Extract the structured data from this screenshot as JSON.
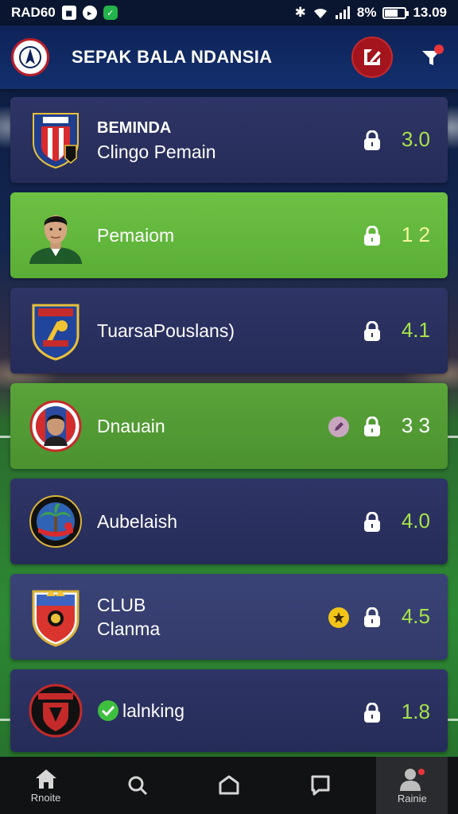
{
  "status_bar": {
    "left_text": "RAD60",
    "battery_text": "8%",
    "time": "13.09"
  },
  "header": {
    "title": "SEPAK BALA NDANSIA"
  },
  "list": [
    {
      "line1": "BEMINDA",
      "line2": "Clingo Pemain",
      "score": "3.0",
      "style": "dark",
      "icon": "club-crest-icon"
    },
    {
      "line1": "Pemaiom",
      "line2": "",
      "score": "1 2",
      "style": "green",
      "icon": "player-portrait-icon"
    },
    {
      "line1": "TuarsaPouslans)",
      "line2": "",
      "score": "4.1",
      "style": "dark",
      "icon": "club-shield-icon"
    },
    {
      "line1": "Dnauain",
      "line2": "",
      "score": "3 3",
      "style": "green2",
      "icon": "player-badge-icon"
    },
    {
      "line1": "Aubelaish",
      "line2": "",
      "score": "4.0",
      "style": "dark",
      "icon": "palm-badge-icon"
    },
    {
      "line1": "CLUB",
      "line2": "Clanma",
      "score": "4.5",
      "style": "light",
      "icon": "lion-crest-icon"
    },
    {
      "line1": "lalnking",
      "line2": "",
      "score": "1.8",
      "style": "dark",
      "icon": "red-crest-icon"
    }
  ],
  "nav": [
    {
      "label": "Rnoite",
      "icon": "home-icon"
    },
    {
      "label": "",
      "icon": "search-icon"
    },
    {
      "label": "",
      "icon": "circle-home-icon"
    },
    {
      "label": "",
      "icon": "message-icon"
    },
    {
      "label": "Rainie",
      "icon": "profile-icon"
    }
  ],
  "colors": {
    "header_bg": "#13306e",
    "card_dark": "#2a3060",
    "card_green": "#66ba40",
    "score": "#a6e24a",
    "accent_red": "#a3141c"
  }
}
